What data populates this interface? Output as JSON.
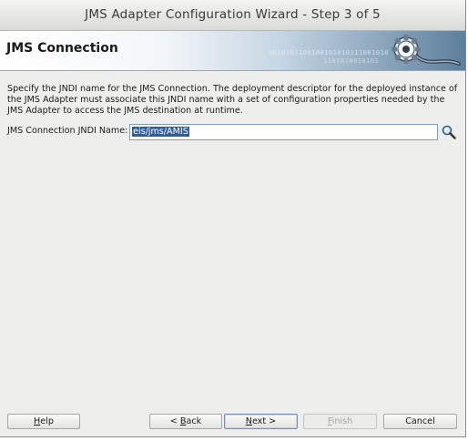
{
  "window": {
    "title": "JMS Adapter Configuration Wizard - Step 3 of 5"
  },
  "banner": {
    "title": "JMS Connection",
    "binary_line1": "0010101100100101010111001010",
    "binary_line2": "1101010010101"
  },
  "content": {
    "description": "Specify the JNDI name for the JMS Connection.  The deployment descriptor for the deployed instance of the JMS Adapter must associate this JNDI name with a set of configuration properties needed by the JMS Adapter to access the JMS destination at runtime.",
    "jndi_label": "JMS Connection JNDI Name:",
    "jndi_value": "eis/jms/AMIS"
  },
  "buttons": {
    "help": {
      "mnemonic": "H",
      "rest": "elp"
    },
    "back": {
      "prefix": "< ",
      "mnemonic": "B",
      "rest": "ack"
    },
    "next": {
      "mnemonic": "N",
      "rest": "ext >"
    },
    "finish": {
      "mnemonic": "F",
      "rest": "inish"
    },
    "cancel": {
      "label": "Cancel"
    }
  },
  "icons": {
    "banner": "gear-cable-icon",
    "search": "magnifier-icon"
  },
  "colors": {
    "selection": "#2d5f9e",
    "banner_dark": "#5d7f9c"
  }
}
